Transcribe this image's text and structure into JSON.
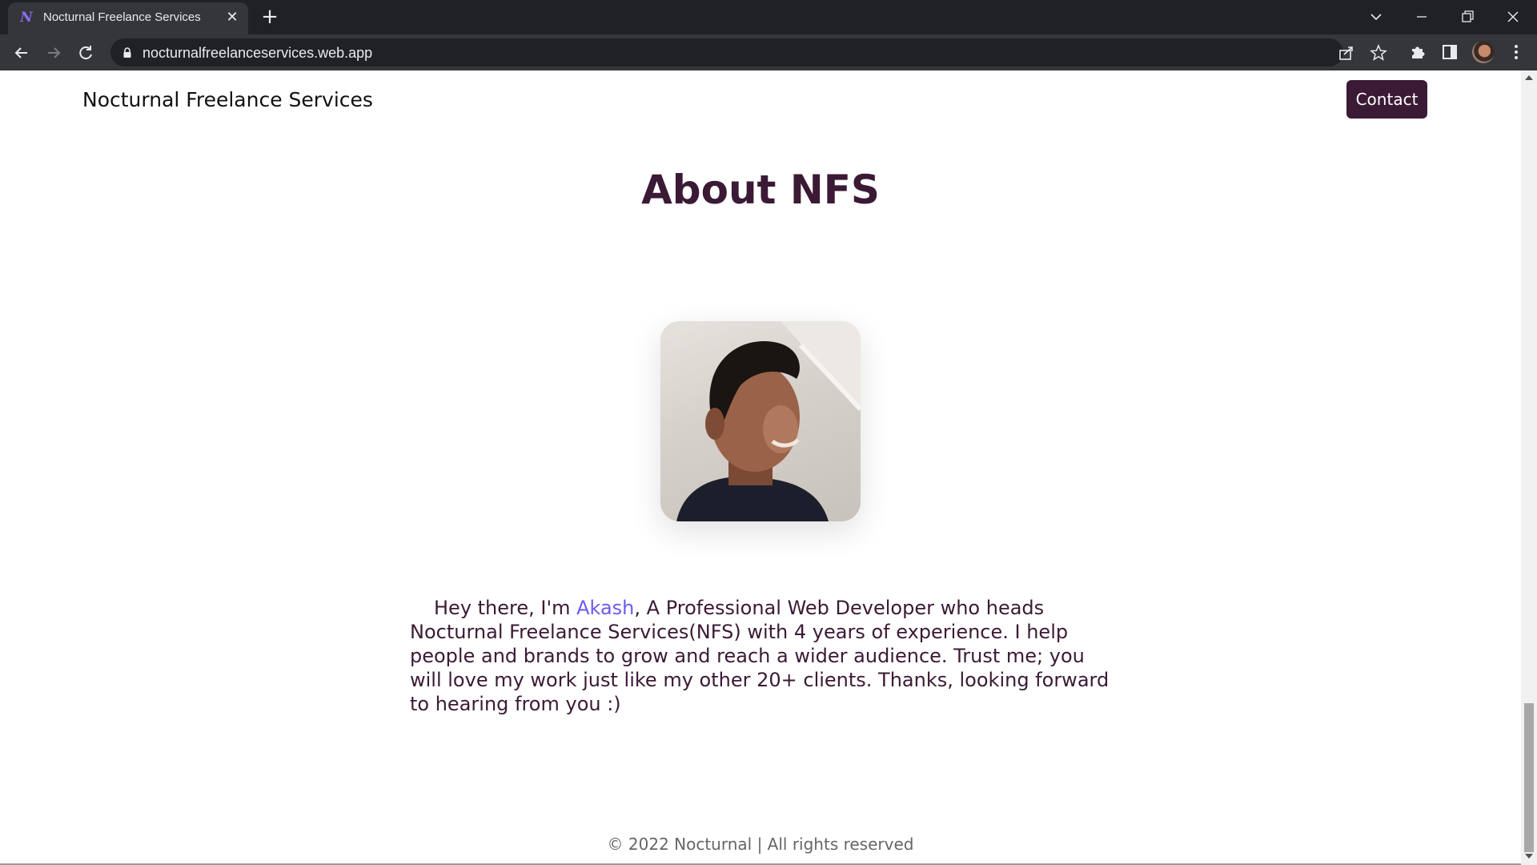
{
  "browser": {
    "tab_title": "Nocturnal Freelance Services",
    "tab_favicon": "N",
    "new_tab_symbol": "+",
    "close_symbol": "✕",
    "url": "nocturnalfreelanceservices.web.app"
  },
  "page": {
    "brand": "Nocturnal Freelance Services",
    "contact_label": "Contact",
    "title": "About NFS",
    "bio": {
      "intro": "Hey there, I'm ",
      "name": "Akash",
      "rest": ", A Professional Web Developer who heads Nocturnal Freelance Services(NFS) with 4 years of experience. I help people and brands to grow and reach a wider audience. Trust me; you will love my work just like my other 20+ clients. Thanks, looking forward to hearing from you :)"
    },
    "footer": "© 2022 Nocturnal | All rights reserved"
  },
  "colors": {
    "accent": "#3b1a35",
    "link": "#6a5cf0",
    "chrome_dark": "#202124",
    "chrome_toolbar": "#35363a"
  },
  "icons": [
    "back-icon",
    "forward-icon",
    "reload-icon",
    "lock-icon",
    "share-icon",
    "star-icon",
    "extensions-icon",
    "side-panel-icon",
    "profile-avatar",
    "menu-icon",
    "tab-search-icon",
    "minimize-icon",
    "restore-icon",
    "close-window-icon"
  ]
}
